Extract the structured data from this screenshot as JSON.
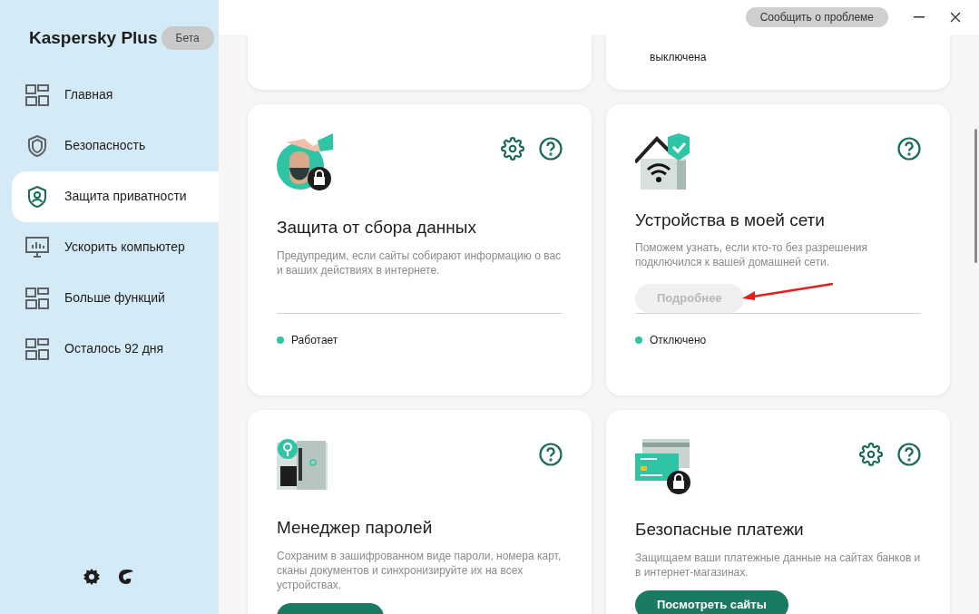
{
  "app": {
    "title": "Kaspersky Plus",
    "badge": "Бета"
  },
  "sidebar": {
    "items": [
      {
        "label": "Главная",
        "kind": "grid",
        "selected": false
      },
      {
        "label": "Безопасность",
        "kind": "shield",
        "selected": false
      },
      {
        "label": "Защита приватности",
        "kind": "privacy",
        "selected": true
      },
      {
        "label": "Ускорить компьютер",
        "kind": "monitor",
        "selected": false
      },
      {
        "label": "Больше функций",
        "kind": "grid",
        "selected": false
      },
      {
        "label": "Осталось 92 дня",
        "kind": "grid",
        "selected": false
      }
    ]
  },
  "top_bar": {
    "report_button": "Сообщить о проблеме"
  },
  "partial_cards": [
    {
      "kind": "blank"
    },
    {
      "kind": "text",
      "text": "выключена"
    }
  ],
  "cards": [
    {
      "title": "Защита от сбора данных",
      "description": "Предупредим, если сайты собирают информацию о вас и ваших действиях в интернете.",
      "kind": "face",
      "settings": true,
      "help": true,
      "status": {
        "label": "Работает",
        "color": "#2ec4a5"
      },
      "pointer_arrow": false
    },
    {
      "title": "Устройства в моей сети",
      "description": "Поможем узнать, если кто-то без разрешения подключился к вашей домашней сети.",
      "kind": "house",
      "settings": false,
      "help": true,
      "button": {
        "label": "Подробнее",
        "disabled": true
      },
      "status": {
        "label": "Отключено",
        "color": "#2ec4a5"
      },
      "pointer_arrow": true
    },
    {
      "title": "Менеджер паролей",
      "description": "Сохраним в зашифрованном виде пароли, номера карт, сканы документов и синхронизируйте их на всех устройствах.",
      "kind": "safe",
      "settings": false,
      "help": true,
      "button": {
        "disabled": false
      },
      "pointer_arrow": false
    },
    {
      "title": "Безопасные платежи",
      "description": "Защищаем ваши платежные данные на сайтах банков и в интернет-магазинах.",
      "kind": "card",
      "settings": true,
      "help": true,
      "button": {
        "label": "Посмотреть сайты",
        "disabled": false
      },
      "pointer_arrow": false
    }
  ]
}
